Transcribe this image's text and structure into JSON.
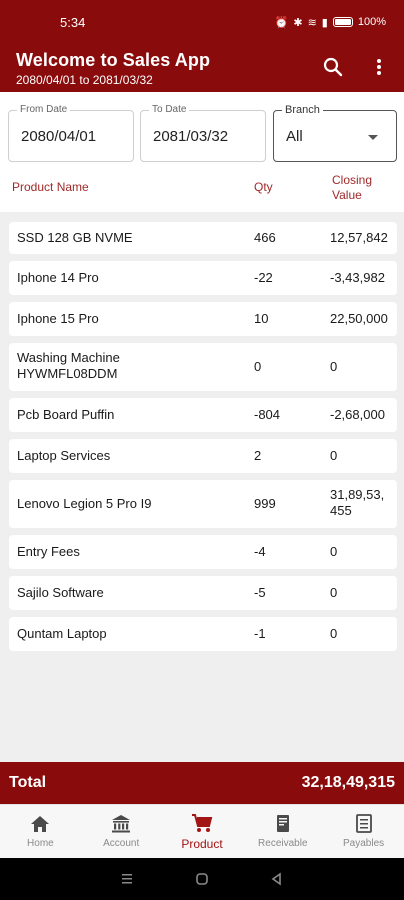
{
  "status_bar": {
    "time": "5:34",
    "battery": "100%"
  },
  "app_bar": {
    "title": "Welcome to Sales App",
    "subtitle": "2080/04/01 to 2081/03/32"
  },
  "filters": {
    "from_label": "From Date",
    "from_value": "2080/04/01",
    "to_label": "To Date",
    "to_value": "2081/03/32",
    "branch_label": "Branch",
    "branch_value": "All"
  },
  "columns": {
    "name": "Product Name",
    "qty": "Qty",
    "value_line1": "Closing",
    "value_line2": "Value"
  },
  "products": [
    {
      "name": "SSD 128 GB NVME",
      "qty": "466",
      "value": "12,57,842"
    },
    {
      "name": "Iphone 14 Pro",
      "qty": "-22",
      "value": "-3,43,982"
    },
    {
      "name": "Iphone 15 Pro",
      "qty": "10",
      "value": "22,50,000"
    },
    {
      "name_line1": "Washing Machine",
      "name_line2": "HYWMFL08DDM",
      "qty": "0",
      "value": "0"
    },
    {
      "name": "Pcb Board Puffin",
      "qty": "-804",
      "value": "-2,68,000"
    },
    {
      "name": "Laptop Services",
      "qty": "2",
      "value": "0"
    },
    {
      "name": "Lenovo Legion 5 Pro I9",
      "qty": "999",
      "value_line1": "31,89,53,",
      "value_line2": "455"
    },
    {
      "name": "Entry Fees",
      "qty": "-4",
      "value": "0"
    },
    {
      "name": "Sajilo Software",
      "qty": "-5",
      "value": "0"
    },
    {
      "name": "Quntam Laptop",
      "qty": "-1",
      "value": "0"
    }
  ],
  "total": {
    "label": "Total",
    "value": "32,18,49,315"
  },
  "nav": {
    "home": "Home",
    "account": "Account",
    "product": "Product",
    "receivable": "Receivable",
    "payables": "Payables"
  },
  "colors": {
    "brand": "#8a0b0b",
    "accent": "#a31515",
    "column_header": "#a12a2a"
  },
  "icons": [
    "search-icon",
    "more-vert-icon",
    "home-icon",
    "bank-icon",
    "cart-icon",
    "receipt-icon",
    "list-icon"
  ]
}
